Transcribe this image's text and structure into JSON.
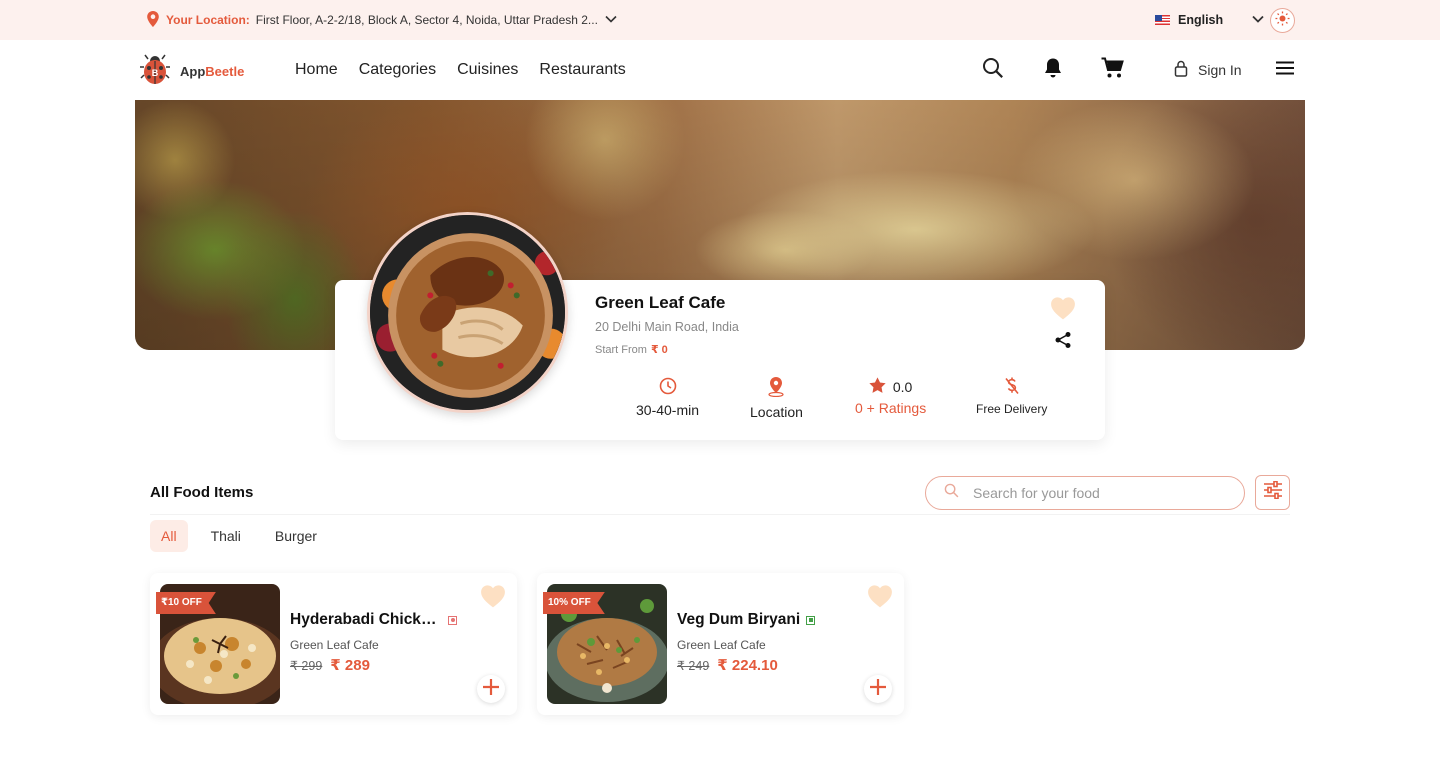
{
  "topbar": {
    "location_label": "Your Location:",
    "location_address": "First Floor, A-2-2/18, Block A, Sector 4, Noida, Uttar Pradesh 2...",
    "language": "English"
  },
  "brand": {
    "part1": "App",
    "part2": "Beetle",
    "accent_color": "#e45a3c"
  },
  "nav": {
    "links": [
      "Home",
      "Categories",
      "Cuisines",
      "Restaurants"
    ],
    "sign_in": "Sign In"
  },
  "restaurant": {
    "name": "Green Leaf Cafe",
    "address": "20 Delhi Main Road, India",
    "start_from_label": "Start From",
    "start_from_value": "₹ 0",
    "delivery_time": "30-40-min",
    "location_label": "Location",
    "rating": "0.0",
    "ratings_count": "0 + Ratings",
    "delivery": "Free Delivery"
  },
  "food_section": {
    "title": "All Food Items",
    "search_placeholder": "Search for your food",
    "tabs": [
      "All",
      "Thali",
      "Burger"
    ],
    "items": [
      {
        "badge": "₹10 OFF",
        "name": "Hyderabadi Chicken Biryani",
        "restaurant": "Green Leaf Cafe",
        "old_price": "₹ 299",
        "new_price": "₹ 289",
        "type": "non-veg"
      },
      {
        "badge": "10% OFF",
        "name": "Veg Dum Biryani",
        "restaurant": "Green Leaf Cafe",
        "old_price": "₹ 249",
        "new_price": "₹ 224.10",
        "type": "veg"
      }
    ]
  }
}
